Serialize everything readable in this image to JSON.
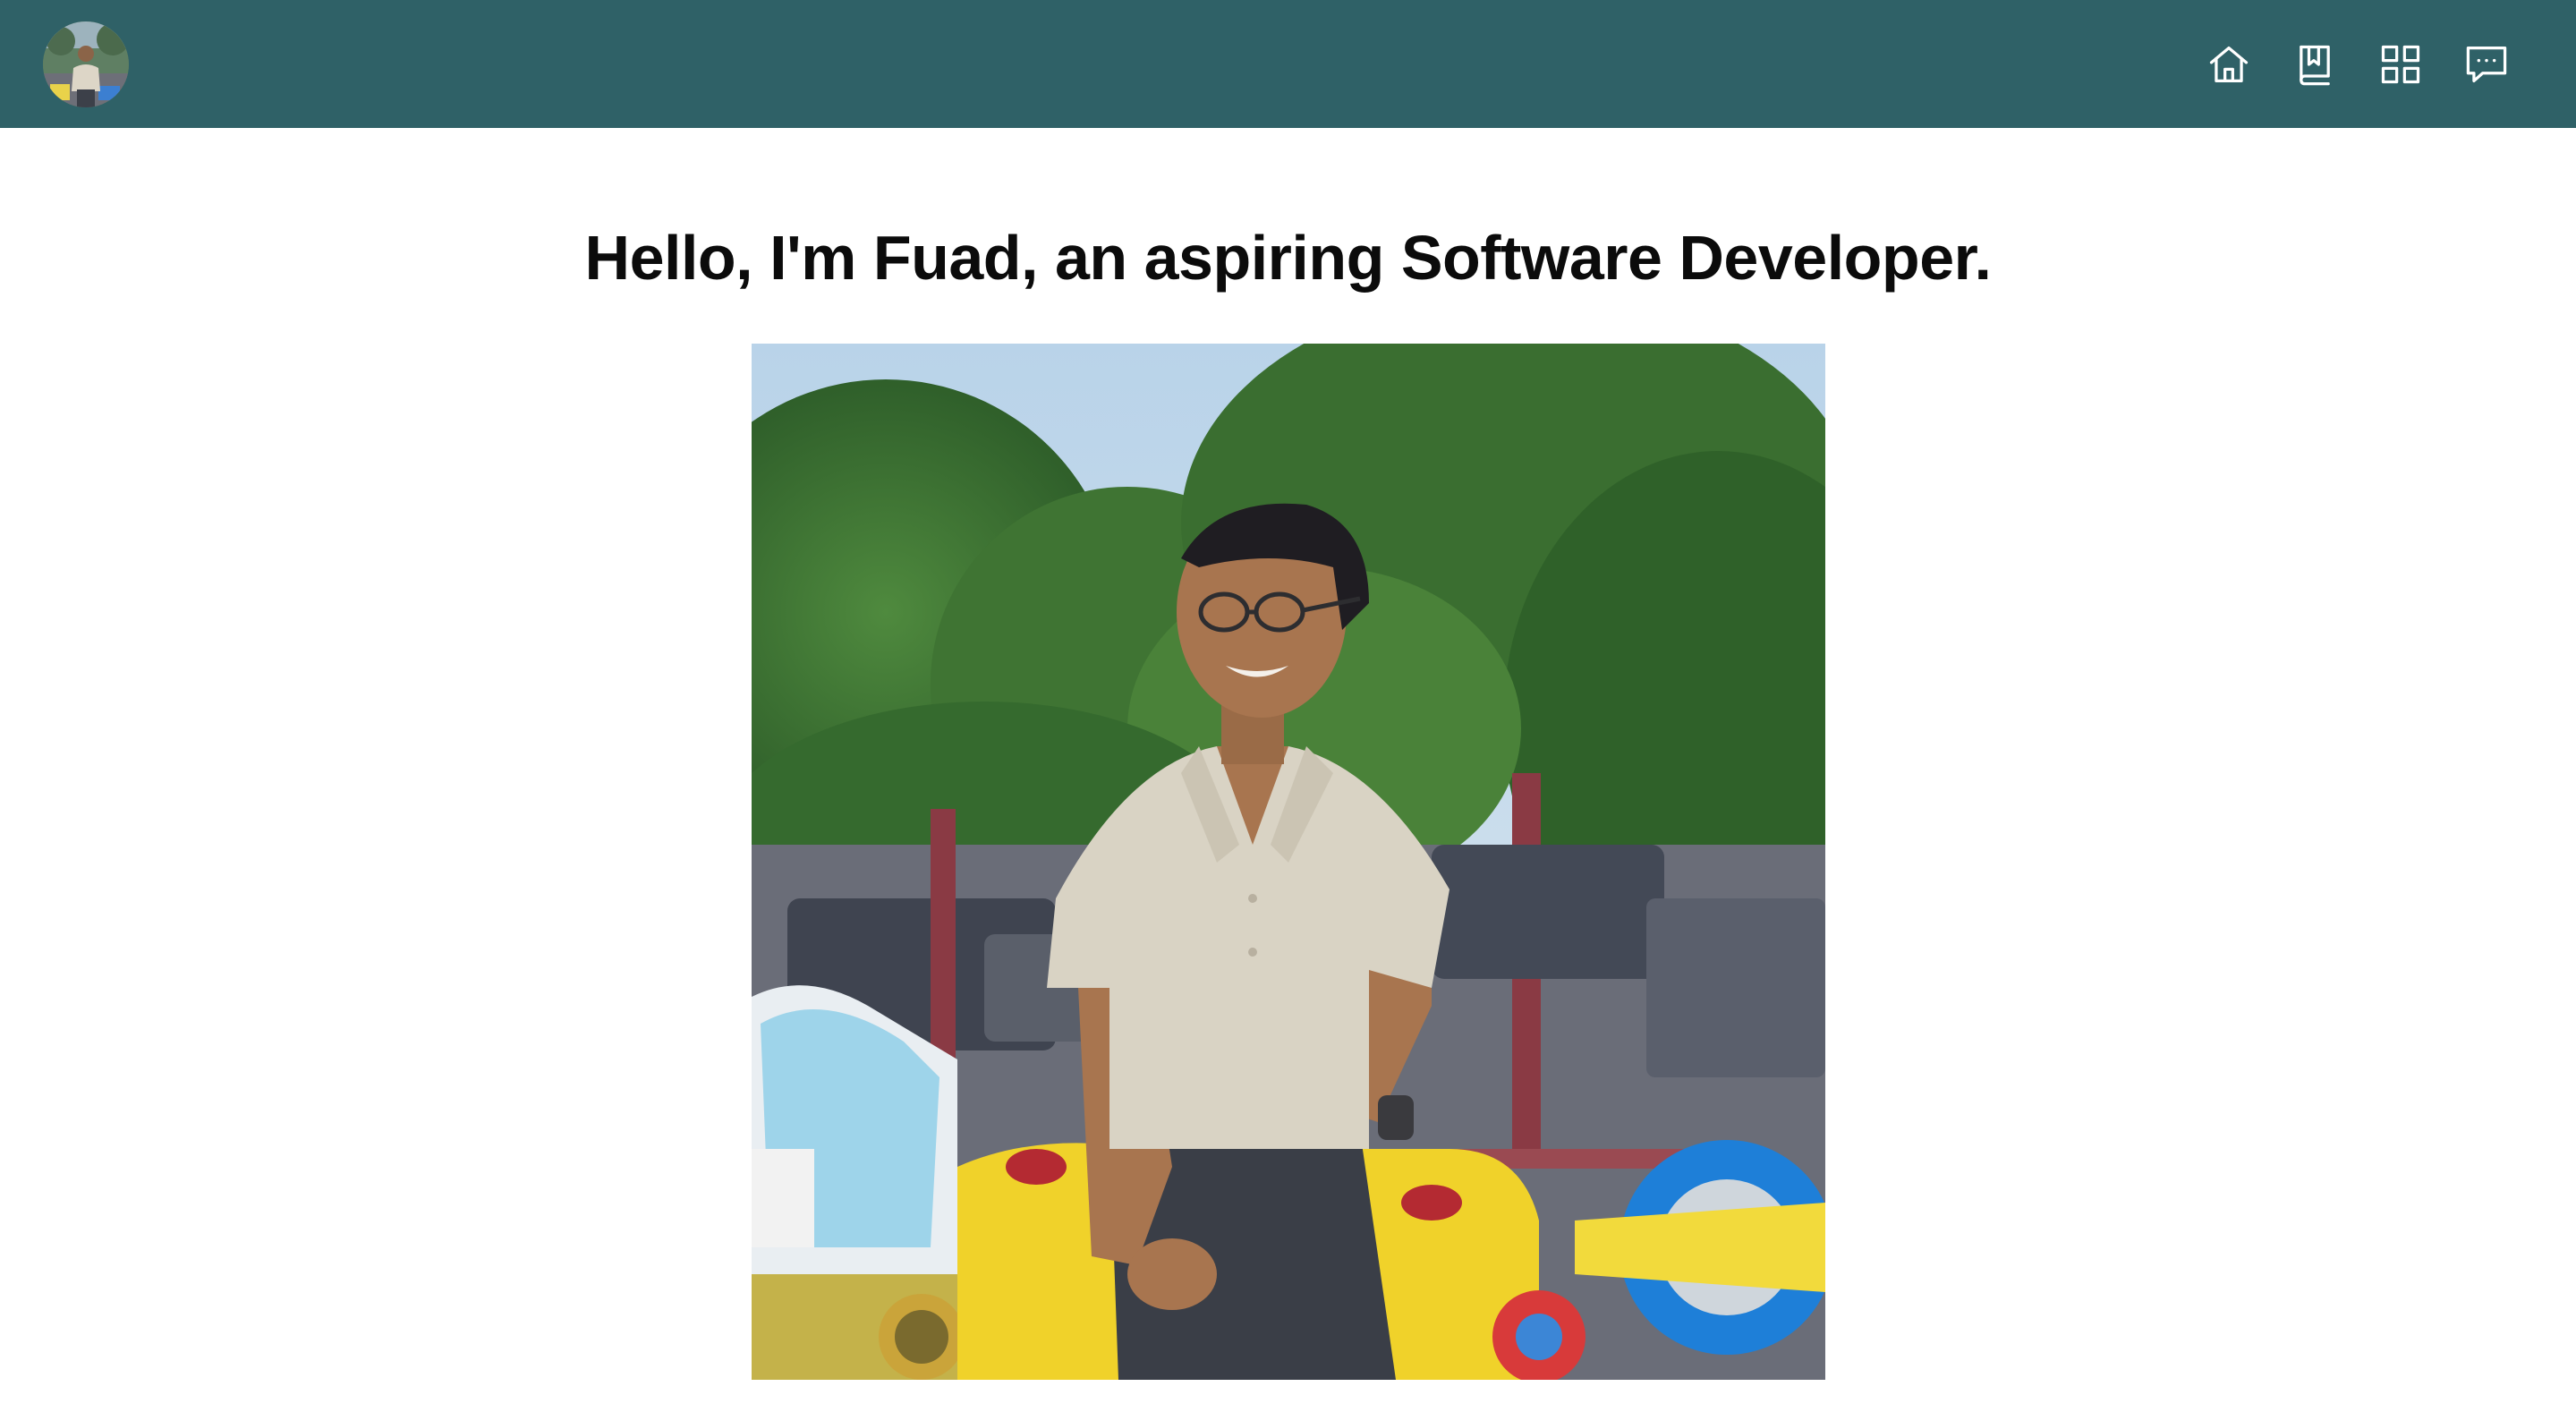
{
  "header": {
    "avatar_label": "profile-avatar",
    "nav": [
      {
        "id": "home",
        "icon": "home-icon"
      },
      {
        "id": "blog",
        "icon": "bookmark-book-icon"
      },
      {
        "id": "projects",
        "icon": "grid-icon"
      },
      {
        "id": "contact",
        "icon": "chat-icon"
      }
    ]
  },
  "hero": {
    "headline": "Hello, I'm Fuad, an aspiring Software Developer.",
    "photo_label": "portrait-photo"
  },
  "colors": {
    "header_bg": "#2f6167",
    "icon_color": "#ffffff",
    "page_bg": "#ffffff",
    "headline_color": "#0b0b0b"
  }
}
